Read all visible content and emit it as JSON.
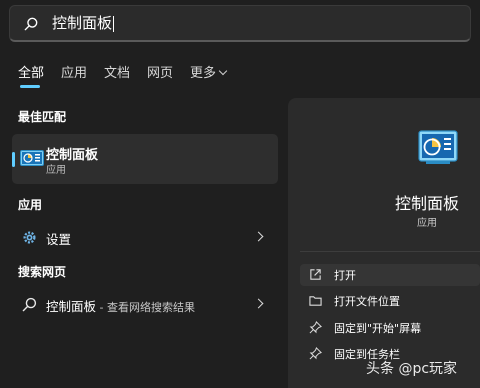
{
  "search": {
    "query": "控制面板"
  },
  "tabs": [
    {
      "label": "全部",
      "active": true
    },
    {
      "label": "应用"
    },
    {
      "label": "文档"
    },
    {
      "label": "网页"
    },
    {
      "label": "更多"
    }
  ],
  "best_match": {
    "heading": "最佳匹配",
    "title": "控制面板",
    "subtitle": "应用"
  },
  "apps": {
    "heading": "应用",
    "items": [
      {
        "label": "设置"
      }
    ]
  },
  "web": {
    "heading": "搜索网页",
    "items": [
      {
        "label": "控制面板",
        "suffix": " - 查看网络搜索结果"
      }
    ]
  },
  "detail": {
    "title": "控制面板",
    "subtitle": "应用",
    "actions": [
      {
        "label": "打开"
      },
      {
        "label": "打开文件位置"
      },
      {
        "label": "固定到\"开始\"屏幕"
      },
      {
        "label": "固定到任务栏"
      }
    ]
  },
  "watermark": "头条 @pc玩家",
  "colors": {
    "accent": "#60cdff",
    "background": "#1f1f1f",
    "panel": "#2b2b2b"
  }
}
